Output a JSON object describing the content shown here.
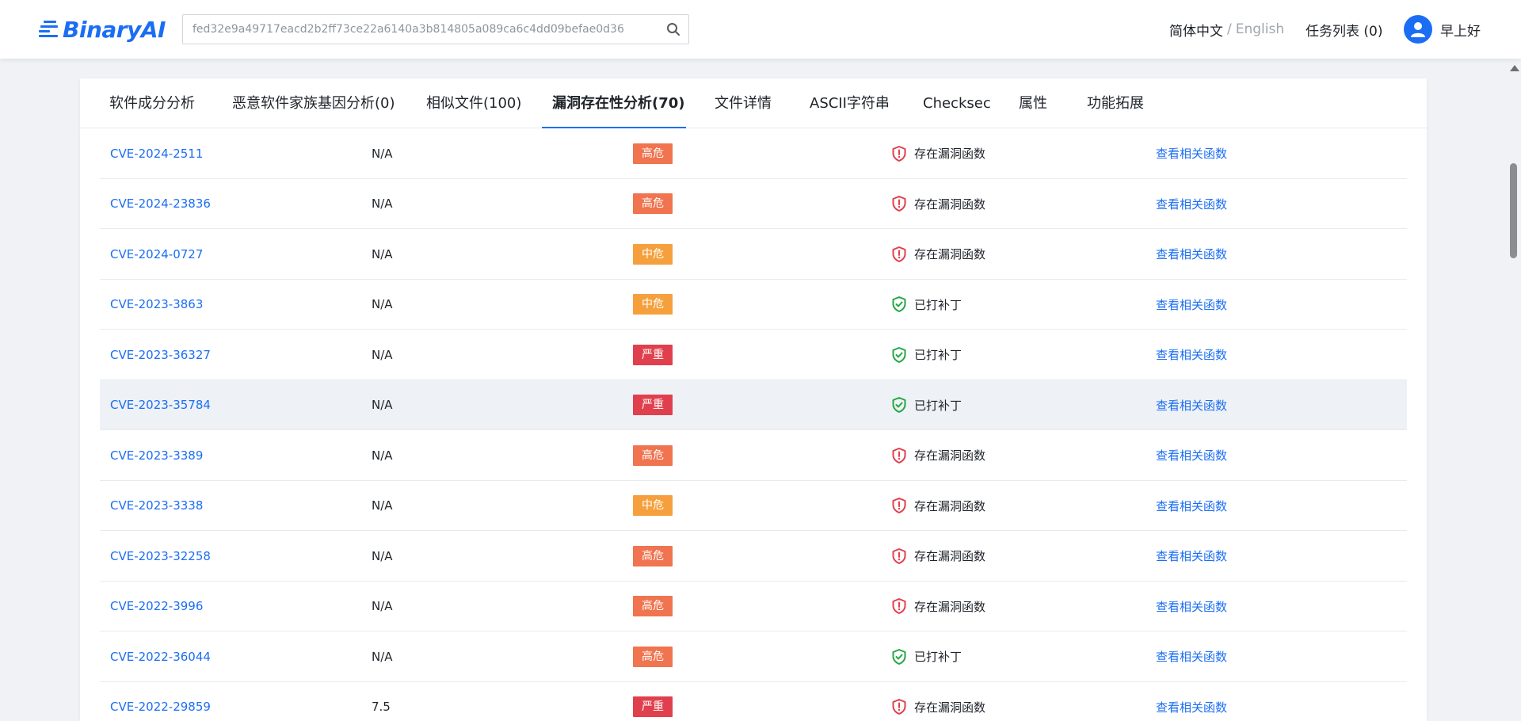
{
  "header": {
    "logo_text": "BinaryAI",
    "search": {
      "value": "fed32e9a49717eacd2b2ff73ce22a6140a3b814805a089ca6c4dd09befae0d36"
    },
    "lang_cn": "简体中文",
    "lang_sep": "/",
    "lang_en": "English",
    "tasks_label": "任务列表 (0)",
    "greeting": "早上好"
  },
  "tabs": [
    {
      "label": "软件成分分析"
    },
    {
      "label": "恶意软件家族基因分析(0)"
    },
    {
      "label": "相似文件(100)"
    },
    {
      "label": "漏洞存在性分析(70)",
      "active": true
    },
    {
      "label": "文件详情"
    },
    {
      "label": "ASCII字符串"
    },
    {
      "label": "Checksec"
    },
    {
      "label": "属性"
    },
    {
      "label": "功能拓展"
    }
  ],
  "colors": {
    "accent": "#1b6ef3",
    "severity_high": "#f0744f",
    "severity_medium": "#f5a03c",
    "severity_critical": "#e0404d",
    "status_vulnerable": "#e0404d",
    "status_patched": "#22a745"
  },
  "rows": [
    {
      "cve": "CVE-2024-2511",
      "score": "N/A",
      "severity": "高危",
      "severity_level": "high",
      "status": "存在漏洞函数",
      "status_type": "vulnerable",
      "status_icon": "shield-alert-icon",
      "action": "查看相关函数"
    },
    {
      "cve": "CVE-2024-23836",
      "score": "N/A",
      "severity": "高危",
      "severity_level": "high",
      "status": "存在漏洞函数",
      "status_type": "vulnerable",
      "status_icon": "shield-alert-icon",
      "action": "查看相关函数"
    },
    {
      "cve": "CVE-2024-0727",
      "score": "N/A",
      "severity": "中危",
      "severity_level": "medium",
      "status": "存在漏洞函数",
      "status_type": "vulnerable",
      "status_icon": "shield-alert-icon",
      "action": "查看相关函数"
    },
    {
      "cve": "CVE-2023-3863",
      "score": "N/A",
      "severity": "中危",
      "severity_level": "medium",
      "status": "已打补丁",
      "status_type": "patched",
      "status_icon": "shield-check-icon",
      "action": "查看相关函数"
    },
    {
      "cve": "CVE-2023-36327",
      "score": "N/A",
      "severity": "严重",
      "severity_level": "critical",
      "status": "已打补丁",
      "status_type": "patched",
      "status_icon": "shield-check-icon",
      "action": "查看相关函数"
    },
    {
      "cve": "CVE-2023-35784",
      "score": "N/A",
      "severity": "严重",
      "severity_level": "critical",
      "status": "已打补丁",
      "status_type": "patched",
      "status_icon": "shield-check-icon",
      "action": "查看相关函数",
      "hovered": true
    },
    {
      "cve": "CVE-2023-3389",
      "score": "N/A",
      "severity": "高危",
      "severity_level": "high",
      "status": "存在漏洞函数",
      "status_type": "vulnerable",
      "status_icon": "shield-alert-icon",
      "action": "查看相关函数"
    },
    {
      "cve": "CVE-2023-3338",
      "score": "N/A",
      "severity": "中危",
      "severity_level": "medium",
      "status": "存在漏洞函数",
      "status_type": "vulnerable",
      "status_icon": "shield-alert-icon",
      "action": "查看相关函数"
    },
    {
      "cve": "CVE-2023-32258",
      "score": "N/A",
      "severity": "高危",
      "severity_level": "high",
      "status": "存在漏洞函数",
      "status_type": "vulnerable",
      "status_icon": "shield-alert-icon",
      "action": "查看相关函数"
    },
    {
      "cve": "CVE-2022-3996",
      "score": "N/A",
      "severity": "高危",
      "severity_level": "high",
      "status": "存在漏洞函数",
      "status_type": "vulnerable",
      "status_icon": "shield-alert-icon",
      "action": "查看相关函数"
    },
    {
      "cve": "CVE-2022-36044",
      "score": "N/A",
      "severity": "高危",
      "severity_level": "high",
      "status": "已打补丁",
      "status_type": "patched",
      "status_icon": "shield-check-icon",
      "action": "查看相关函数"
    },
    {
      "cve": "CVE-2022-29859",
      "score": "7.5",
      "severity": "严重",
      "severity_level": "critical",
      "status": "存在漏洞函数",
      "status_type": "vulnerable",
      "status_icon": "shield-alert-icon",
      "action": "查看相关函数"
    }
  ]
}
